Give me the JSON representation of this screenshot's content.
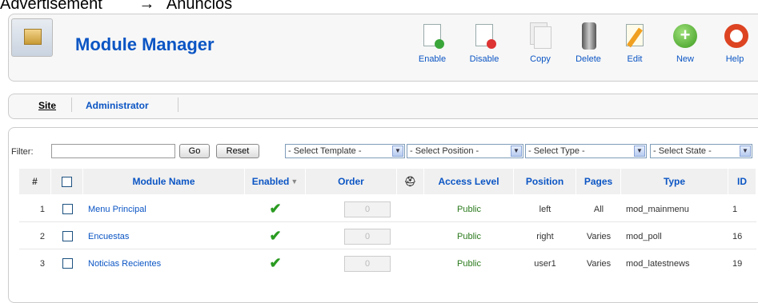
{
  "breadcrumb": {
    "left": "Advertisement",
    "right": "Anuncios"
  },
  "header": {
    "title": "Module Manager"
  },
  "toolbar": [
    {
      "label": "Enable",
      "icon": "enable-icon"
    },
    {
      "label": "Disable",
      "icon": "disable-icon"
    },
    {
      "label": "Copy",
      "icon": "copy-icon"
    },
    {
      "label": "Delete",
      "icon": "delete-icon"
    },
    {
      "label": "Edit",
      "icon": "edit-icon"
    },
    {
      "label": "New",
      "icon": "new-icon"
    },
    {
      "label": "Help",
      "icon": "help-icon"
    }
  ],
  "submenu": {
    "site": "Site",
    "administrator": "Administrator"
  },
  "filter": {
    "label": "Filter:",
    "value": "",
    "go": "Go",
    "reset": "Reset",
    "template": "- Select Template -",
    "position": "- Select Position -",
    "type": "- Select Type -",
    "state": "- Select State -"
  },
  "table": {
    "headers": {
      "num": "#",
      "name": "Module Name",
      "enabled": "Enabled",
      "order": "Order",
      "access": "Access Level",
      "position": "Position",
      "pages": "Pages",
      "type": "Type",
      "id": "ID"
    },
    "rows": [
      {
        "num": "1",
        "name": "Menu Principal",
        "order": "0",
        "access": "Public",
        "position": "left",
        "pages": "All",
        "type": "mod_mainmenu",
        "id": "1"
      },
      {
        "num": "2",
        "name": "Encuestas",
        "order": "0",
        "access": "Public",
        "position": "right",
        "pages": "Varies",
        "type": "mod_poll",
        "id": "16"
      },
      {
        "num": "3",
        "name": "Noticias Recientes",
        "order": "0",
        "access": "Public",
        "position": "user1",
        "pages": "Varies",
        "type": "mod_latestnews",
        "id": "19"
      }
    ]
  },
  "colors": {
    "link": "#0b55c4",
    "check": "#2a9b21",
    "header_bg": "#f0f0f0"
  }
}
